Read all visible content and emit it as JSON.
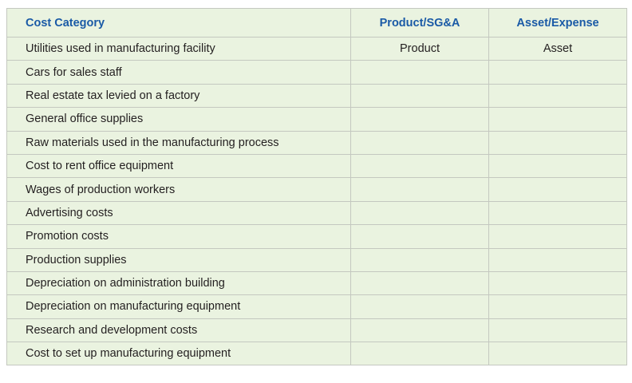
{
  "table": {
    "headers": [
      "Cost Category",
      "Product/SG&A",
      "Asset/Expense"
    ],
    "rows": [
      [
        "Utilities used in manufacturing facility",
        "Product",
        "Asset"
      ],
      [
        "Cars for sales staff",
        "",
        ""
      ],
      [
        "Real estate tax levied on a factory",
        "",
        ""
      ],
      [
        "General office supplies",
        "",
        ""
      ],
      [
        "Raw materials used in the manufacturing process",
        "",
        ""
      ],
      [
        "Cost to rent office equipment",
        "",
        ""
      ],
      [
        "Wages of production workers",
        "",
        ""
      ],
      [
        "Advertising costs",
        "",
        ""
      ],
      [
        "Promotion costs",
        "",
        ""
      ],
      [
        "Production supplies",
        "",
        ""
      ],
      [
        "Depreciation on administration building",
        "",
        ""
      ],
      [
        "Depreciation on manufacturing equipment",
        "",
        ""
      ],
      [
        "Research and development costs",
        "",
        ""
      ],
      [
        "Cost to set up manufacturing equipment",
        "",
        ""
      ]
    ]
  },
  "colors": {
    "header_text": "#1a5aa6",
    "cell_background": "#eaf3e0",
    "grid_line": "#c4c8c0"
  }
}
